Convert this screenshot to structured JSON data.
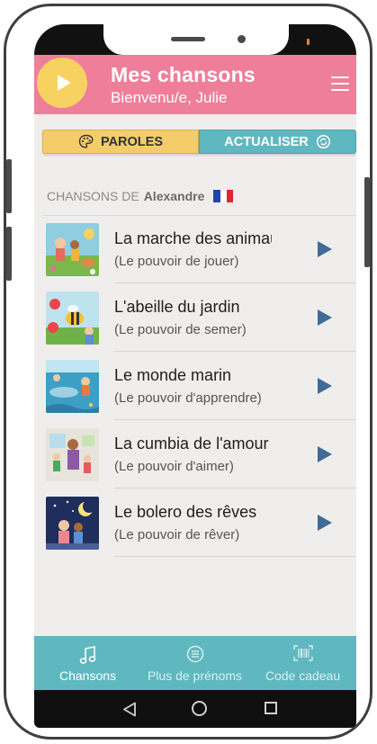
{
  "header": {
    "title": "Mes chansons",
    "subtitle": "Bienvenu/e, Julie",
    "colors": {
      "header_bg": "#ef7e9a",
      "play_bg": "#f7d260"
    }
  },
  "actions": {
    "paroles_label": "PAROLES",
    "actualiser_label": "ACTUALISER"
  },
  "section": {
    "prefix": "CHANSONS DE",
    "name": "Alexandre",
    "flag": "france-flag"
  },
  "songs": [
    {
      "title": "La marche des animaux",
      "subtitle": "(Le pouvoir de jouer)"
    },
    {
      "title": "L'abeille du jardin",
      "subtitle": "(Le pouvoir de semer)"
    },
    {
      "title": "Le monde marin",
      "subtitle": "(Le pouvoir d'apprendre)"
    },
    {
      "title": "La cumbia de l'amour",
      "subtitle": "(Le pouvoir d'aimer)"
    },
    {
      "title": "Le bolero des rêves",
      "subtitle": "(Le pouvoir de rêver)"
    }
  ],
  "nav": {
    "items": [
      {
        "label": "Chansons",
        "icon": "music-note-icon",
        "active": true
      },
      {
        "label": "Plus de prénoms",
        "icon": "list-icon",
        "active": false
      },
      {
        "label": "Code cadeau",
        "icon": "barcode-icon",
        "active": false
      }
    ],
    "color": "#5fb8bf"
  }
}
